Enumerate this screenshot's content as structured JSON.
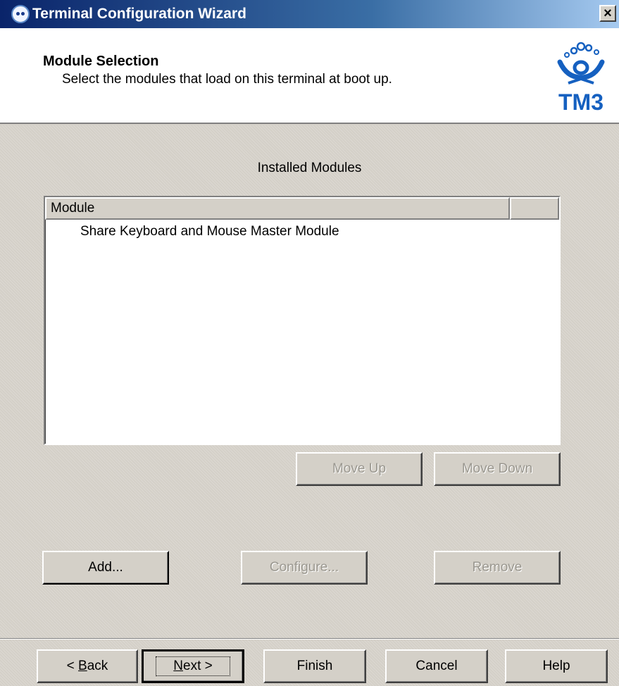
{
  "window": {
    "title": "Terminal Configuration Wizard",
    "close_label": "×"
  },
  "header": {
    "title": "Module Selection",
    "subtitle": "Select the modules that load on this terminal at boot up.",
    "logo_text": "TM3"
  },
  "main": {
    "section_label": "Installed Modules",
    "list": {
      "columns": [
        "Module"
      ],
      "rows": [
        "Share Keyboard and Mouse Master Module"
      ]
    },
    "move_up_label": "Move Up",
    "move_down_label": "Move Down",
    "add_label": "Add...",
    "configure_label": "Configure...",
    "remove_label": "Remove"
  },
  "footer": {
    "back_prefix": "< ",
    "back_accel": "B",
    "back_rest": "ack",
    "next_accel": "N",
    "next_rest": "ext >",
    "finish_label": "Finish",
    "cancel_label": "Cancel",
    "help_label": "Help"
  },
  "colors": {
    "titlebar_start": "#0a246a",
    "titlebar_end": "#a6caf0",
    "face": "#d4d0c8",
    "logo_blue": "#1560c0"
  }
}
